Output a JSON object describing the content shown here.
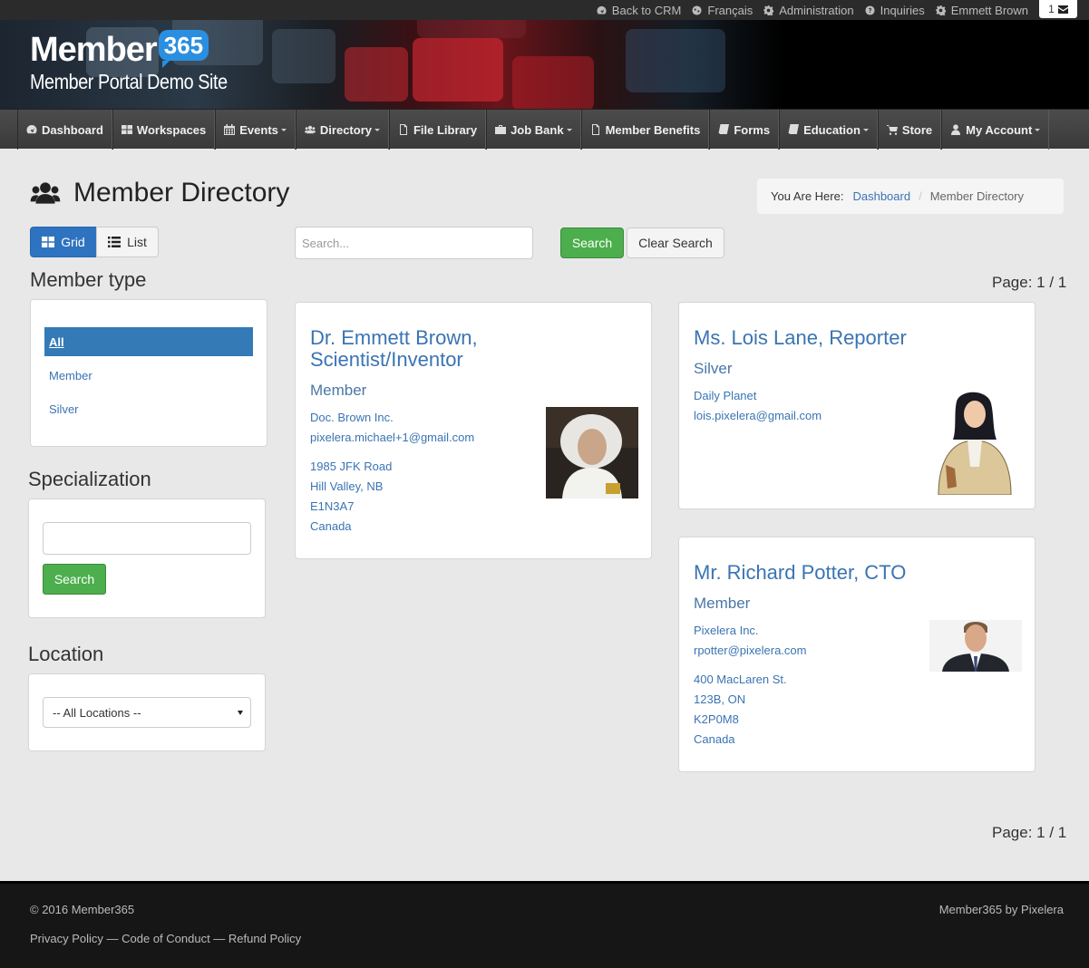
{
  "topbar": {
    "back_to_crm": "Back to CRM",
    "language": "Français",
    "administration": "Administration",
    "inquiries": "Inquiries",
    "user": "Emmett Brown",
    "mail_count": "1"
  },
  "nav": {
    "dashboard": "Dashboard",
    "workspaces": "Workspaces",
    "events": "Events",
    "directory": "Directory",
    "file_library": "File Library",
    "job_bank": "Job Bank",
    "member_benefits": "Member Benefits",
    "forms": "Forms",
    "education": "Education",
    "store": "Store",
    "my_account": "My Account"
  },
  "page": {
    "title": "Member Directory",
    "breadcrumb_label": "You Are Here:",
    "breadcrumb_home": "Dashboard",
    "breadcrumb_current": "Member Directory"
  },
  "view": {
    "grid": "Grid",
    "list": "List"
  },
  "search": {
    "placeholder": "Search...",
    "search": "Search",
    "clear": "Clear Search"
  },
  "pager": {
    "top": "Page: 1 / 1",
    "bottom": "Page: 1 / 1"
  },
  "sidebar": {
    "member_type_heading": "Member type",
    "member_types": [
      "All",
      "Member",
      "Silver"
    ],
    "specialization_heading": "Specialization",
    "specialization_button": "Search",
    "location_heading": "Location",
    "location_selected": "-- All Locations --"
  },
  "members": [
    {
      "name_line1": "Dr. Emmett Brown,",
      "name_line2": "Scientist/Inventor",
      "type": "Member",
      "company": "Doc. Brown Inc.",
      "email": "pixelera.michael+1@gmail.com",
      "address1": "1985 JFK Road",
      "address2": "Hill Valley, NB",
      "postal": "E1N3A7",
      "country": "Canada"
    },
    {
      "name_line1": "Ms. Lois Lane, Reporter",
      "type": "Silver",
      "company": "Daily Planet",
      "email": "lois.pixelera@gmail.com"
    },
    {
      "name_line1": "Mr. Richard Potter, CTO",
      "type": "Member",
      "company": "Pixelera Inc.",
      "email": "rpotter@pixelera.com",
      "address1": "400 MacLaren St.",
      "address2": "123B, ON",
      "postal": "K2P0M8",
      "country": "Canada"
    }
  ],
  "footer": {
    "copyright": "© 2016 Member365",
    "links": "Privacy Policy — Code of Conduct — Refund Policy",
    "credit": "Member365 by Pixelera"
  },
  "brand": {
    "logo_word": "Member",
    "logo_number": "365",
    "logo_subtitle": "Member Portal Demo Site"
  },
  "colors": {
    "primary": "#2e73c0",
    "success": "#4cae4c",
    "link": "#3a74b3",
    "nav": "#444444",
    "footer": "#161616"
  }
}
